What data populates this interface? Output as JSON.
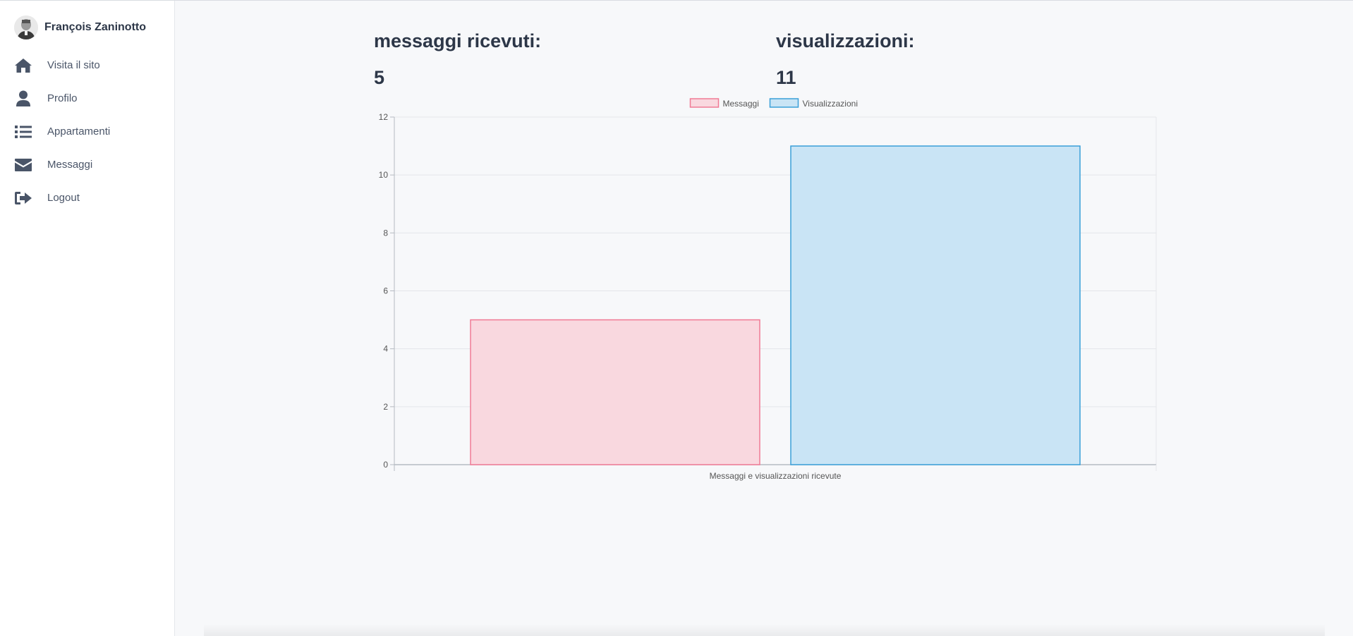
{
  "sidebar": {
    "user_name": "François Zaninotto",
    "items": [
      {
        "label": "Visita il sito",
        "icon": "home-icon"
      },
      {
        "label": "Profilo",
        "icon": "user-icon"
      },
      {
        "label": "Appartamenti",
        "icon": "list-icon"
      },
      {
        "label": "Messaggi",
        "icon": "envelope-icon"
      },
      {
        "label": "Logout",
        "icon": "sign-out-icon"
      }
    ]
  },
  "stats": {
    "messages_title": "messaggi ricevuti:",
    "messages_value": "5",
    "views_title": "visualizzazioni:",
    "views_value": "11"
  },
  "chart_data": {
    "type": "bar",
    "categories": [
      "Messaggi e visualizzazioni ricevute"
    ],
    "series": [
      {
        "name": "Messaggi",
        "values": [
          5
        ],
        "fill": "#f9d8df",
        "stroke": "#f07a95"
      },
      {
        "name": "Visualizzazioni",
        "values": [
          11
        ],
        "fill": "#c9e4f5",
        "stroke": "#3a9fd8"
      }
    ],
    "xlabel": "",
    "ylabel": "",
    "ylim": [
      0,
      12
    ],
    "yticks": [
      0,
      2,
      4,
      6,
      8,
      10,
      12
    ],
    "grid": true,
    "legend_position": "top"
  },
  "colors": {
    "icon": "#4a5568",
    "grid": "#e4e6ea",
    "axis": "#b6bac1",
    "tick_text": "#555555"
  }
}
